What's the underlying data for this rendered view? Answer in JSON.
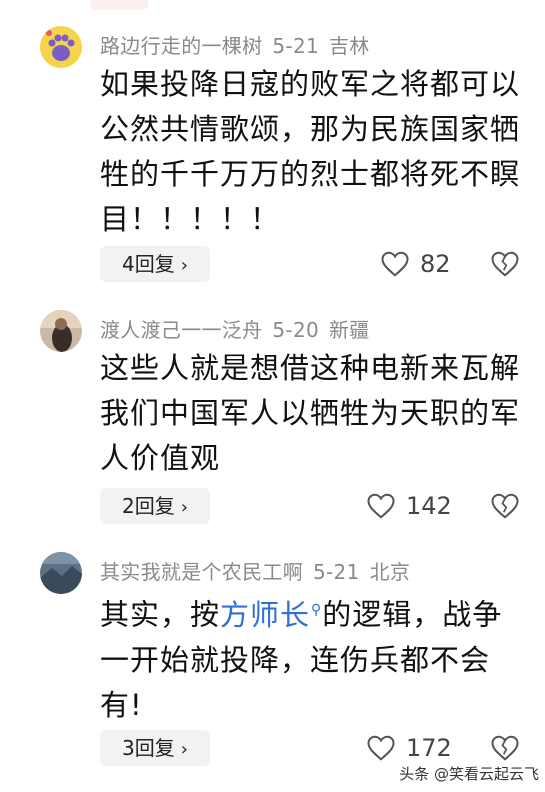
{
  "comments": [
    {
      "username": "路边行走的一棵树",
      "date": "5-21",
      "location": "吉林",
      "text": "如果投降日寇的败军之将都可以公然共情歌颂，那为民族国家牺牲的千千万万的烈士都将死不瞑目！！！！！",
      "reply_label": "4回复",
      "likes": "82"
    },
    {
      "username": "渡人渡己一一泛舟",
      "date": "5-20",
      "location": "新疆",
      "text": "这些人就是想借这种电新来瓦解我们中国军人以牺牲为天职的军人价值观",
      "reply_label": "2回复",
      "likes": "142"
    },
    {
      "username": "其实我就是个农民工啊",
      "date": "5-21",
      "location": "北京",
      "text_before": "其实，按",
      "link_text": "方师长",
      "text_after": "的逻辑，战争一开始就投降，连伤兵都不会有!",
      "reply_label": "3回复",
      "likes": "172"
    }
  ],
  "watermark": "头条 @笑看云起云飞",
  "colors": {
    "link": "#2f6fd6",
    "meta": "#8a8a8a",
    "reply_bg": "#f2f2f2"
  },
  "icons": [
    "heart-icon",
    "broken-heart-icon",
    "chevron-right-icon",
    "search-icon"
  ]
}
